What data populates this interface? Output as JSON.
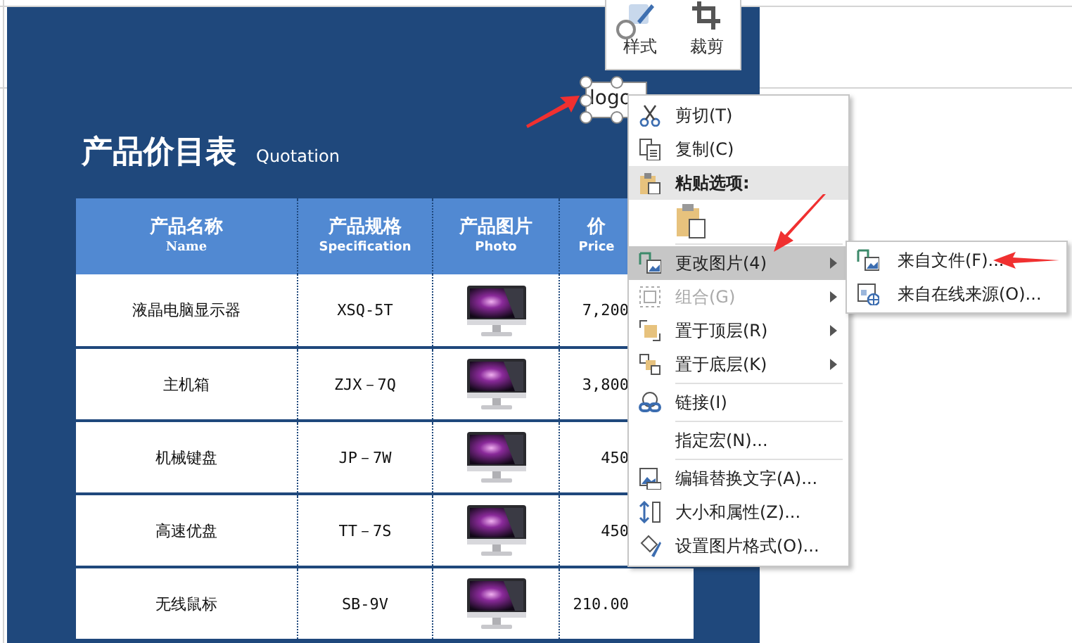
{
  "sheet": {
    "title": "产品价目表",
    "subtitle": "Quotation",
    "logo": "logo",
    "table": {
      "columns": [
        {
          "label": "产品名称",
          "sublabel": "Name"
        },
        {
          "label": "产品规格",
          "sublabel": "Specification"
        },
        {
          "label": "产品图片",
          "sublabel": "Photo"
        },
        {
          "label": "价",
          "sublabel": "Price"
        }
      ],
      "rows": [
        {
          "name": "液晶电脑显示器",
          "spec": "XSQ-5T",
          "price": "7,200"
        },
        {
          "name": "主机箱",
          "spec": "ZJX－7Q",
          "price": "3,800"
        },
        {
          "name": "机械键盘",
          "spec": "JP－7W",
          "price": "450"
        },
        {
          "name": "高速优盘",
          "spec": "TT－7S",
          "price": "450"
        },
        {
          "name": "无线鼠标",
          "spec": "SB-9V",
          "price": "210.00"
        }
      ]
    }
  },
  "toolbar": {
    "buttons": [
      {
        "label": "样式"
      },
      {
        "label": "裁剪"
      }
    ]
  },
  "context_menu": {
    "items": [
      {
        "kind": "item",
        "label": "剪切(T)",
        "selected": false,
        "disabled": false,
        "has_submenu": false
      },
      {
        "kind": "item",
        "label": "复制(C)",
        "selected": false,
        "disabled": false,
        "has_submenu": false
      },
      {
        "kind": "header",
        "label": "粘贴选项:"
      },
      {
        "kind": "paste"
      },
      {
        "kind": "separator"
      },
      {
        "kind": "item",
        "label": "更改图片(4)",
        "selected": true,
        "disabled": false,
        "has_submenu": true
      },
      {
        "kind": "item",
        "label": "组合(G)",
        "selected": false,
        "disabled": true,
        "has_submenu": true
      },
      {
        "kind": "item",
        "label": "置于顶层(R)",
        "selected": false,
        "disabled": false,
        "has_submenu": true
      },
      {
        "kind": "item",
        "label": "置于底层(K)",
        "selected": false,
        "disabled": false,
        "has_submenu": true
      },
      {
        "kind": "separator"
      },
      {
        "kind": "item",
        "label": "链接(I)",
        "selected": false,
        "disabled": false,
        "has_submenu": false
      },
      {
        "kind": "separator"
      },
      {
        "kind": "item",
        "label": "指定宏(N)...",
        "selected": false,
        "disabled": false,
        "has_submenu": false
      },
      {
        "kind": "separator"
      },
      {
        "kind": "item",
        "label": "编辑替换文字(A)...",
        "selected": false,
        "disabled": false,
        "has_submenu": false
      },
      {
        "kind": "item",
        "label": "大小和属性(Z)...",
        "selected": false,
        "disabled": false,
        "has_submenu": false
      },
      {
        "kind": "item",
        "label": "设置图片格式(O)...",
        "selected": false,
        "disabled": false,
        "has_submenu": false
      }
    ]
  },
  "submenu": {
    "items": [
      {
        "label": "来自文件(F)...",
        "selected": false
      },
      {
        "label": "来自在线来源(O)...",
        "selected": false
      }
    ]
  }
}
